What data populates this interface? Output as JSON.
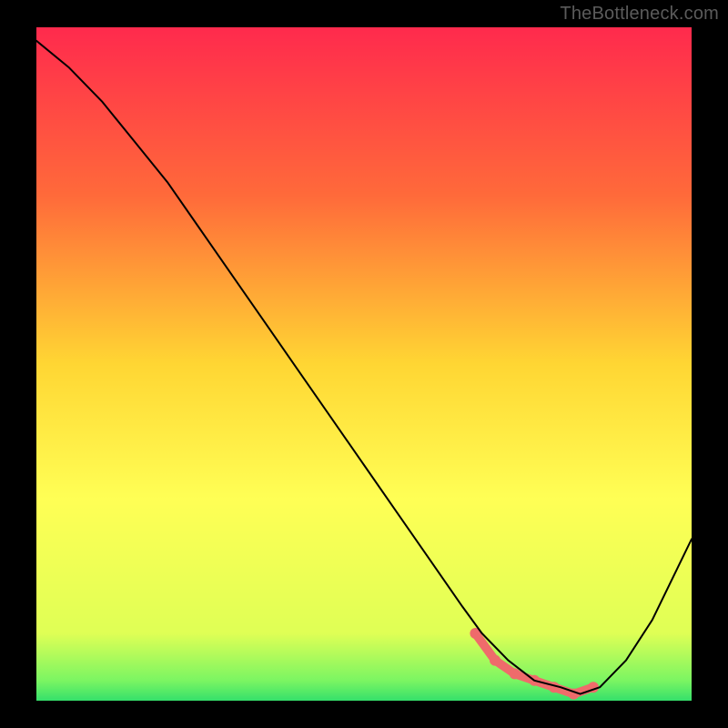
{
  "watermark": "TheBottleneck.com",
  "chart_data": {
    "type": "line",
    "title": "",
    "xlabel": "",
    "ylabel": "",
    "xlim": [
      0,
      100
    ],
    "ylim": [
      0,
      100
    ],
    "grid": false,
    "background_gradient": {
      "orientation": "vertical",
      "stops": [
        {
          "offset": 0.0,
          "color": "#ff2a4d"
        },
        {
          "offset": 0.25,
          "color": "#ff6a3a"
        },
        {
          "offset": 0.5,
          "color": "#ffd633"
        },
        {
          "offset": 0.7,
          "color": "#ffff55"
        },
        {
          "offset": 0.9,
          "color": "#dfff55"
        },
        {
          "offset": 0.97,
          "color": "#7bf562"
        },
        {
          "offset": 1.0,
          "color": "#35e06b"
        }
      ]
    },
    "series": [
      {
        "name": "curve",
        "color": "#000000",
        "stroke_width": 2,
        "x": [
          0,
          5,
          10,
          15,
          20,
          25,
          30,
          35,
          40,
          45,
          50,
          55,
          60,
          65,
          68,
          72,
          76,
          80,
          83,
          86,
          90,
          94,
          100
        ],
        "y": [
          98,
          94,
          89,
          83,
          77,
          70,
          63,
          56,
          49,
          42,
          35,
          28,
          21,
          14,
          10,
          6,
          3,
          2,
          1,
          2,
          6,
          12,
          24
        ]
      }
    ],
    "markers": {
      "name": "highlight",
      "color": "#ef6b6b",
      "radius": 6,
      "x": [
        67,
        70,
        73,
        76,
        79,
        82,
        85
      ],
      "y": [
        10,
        6,
        4,
        3,
        2,
        1,
        2
      ]
    }
  }
}
